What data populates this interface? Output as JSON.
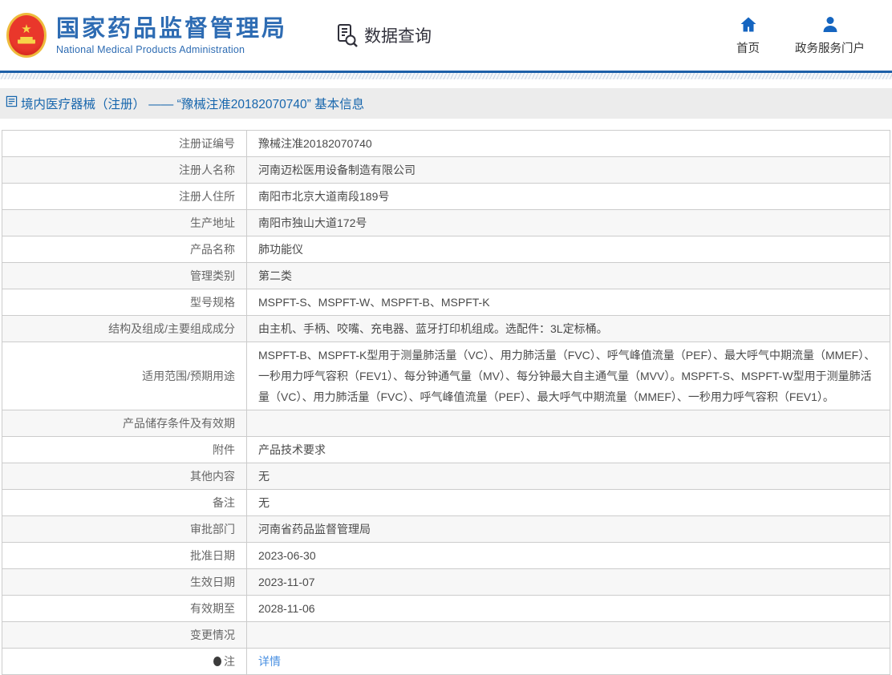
{
  "header": {
    "logo": {
      "title_cn": "国家药品监督管理局",
      "title_en": "National Medical Products Administration"
    },
    "data_query_label": "数据查询",
    "nav": [
      {
        "label": "首页"
      },
      {
        "label": "政务服务门户"
      }
    ]
  },
  "breadcrumb": {
    "text": "境内医疗器械（注册） —— “豫械注准20182070740” 基本信息"
  },
  "colors": {
    "brand_blue": "#2e6cb3",
    "rule_blue": "#1b5fa8",
    "link_blue": "#4a90e2",
    "band_gray": "#ececec",
    "row_alt_gray": "#f7f7f7",
    "border_gray": "#cccccc"
  },
  "table": {
    "rows": [
      {
        "label": "注册证编号",
        "value": "豫械注准20182070740"
      },
      {
        "label": "注册人名称",
        "value": "河南迈松医用设备制造有限公司"
      },
      {
        "label": "注册人住所",
        "value": "南阳市北京大道南段189号"
      },
      {
        "label": "生产地址",
        "value": "南阳市独山大道172号"
      },
      {
        "label": "产品名称",
        "value": "肺功能仪"
      },
      {
        "label": "管理类别",
        "value": "第二类"
      },
      {
        "label": "型号规格",
        "value": "MSPFT-S、MSPFT-W、MSPFT-B、MSPFT-K"
      },
      {
        "label": "结构及组成/主要组成成分",
        "value": "由主机、手柄、咬嘴、充电器、蓝牙打印机组成。选配件：3L定标桶。"
      },
      {
        "label": "适用范围/预期用途",
        "value": "MSPFT-B、MSPFT-K型用于测量肺活量（VC）、用力肺活量（FVC）、呼气峰值流量（PEF）、最大呼气中期流量（MMEF）、一秒用力呼气容积（FEV1）、每分钟通气量（MV）、每分钟最大自主通气量（MVV）。MSPFT-S、MSPFT-W型用于测量肺活量（VC）、用力肺活量（FVC）、呼气峰值流量（PEF）、最大呼气中期流量（MMEF）、一秒用力呼气容积（FEV1）。"
      },
      {
        "label": "产品储存条件及有效期",
        "value": ""
      },
      {
        "label": "附件",
        "value": "产品技术要求"
      },
      {
        "label": "其他内容",
        "value": "无"
      },
      {
        "label": "备注",
        "value": "无"
      },
      {
        "label": "审批部门",
        "value": "河南省药品监督管理局"
      },
      {
        "label": "批准日期",
        "value": "2023-06-30"
      },
      {
        "label": "生效日期",
        "value": "2023-11-07"
      },
      {
        "label": "有效期至",
        "value": "2028-11-06"
      },
      {
        "label": "变更情况",
        "value": ""
      },
      {
        "label": "注",
        "value": "详情"
      }
    ]
  }
}
